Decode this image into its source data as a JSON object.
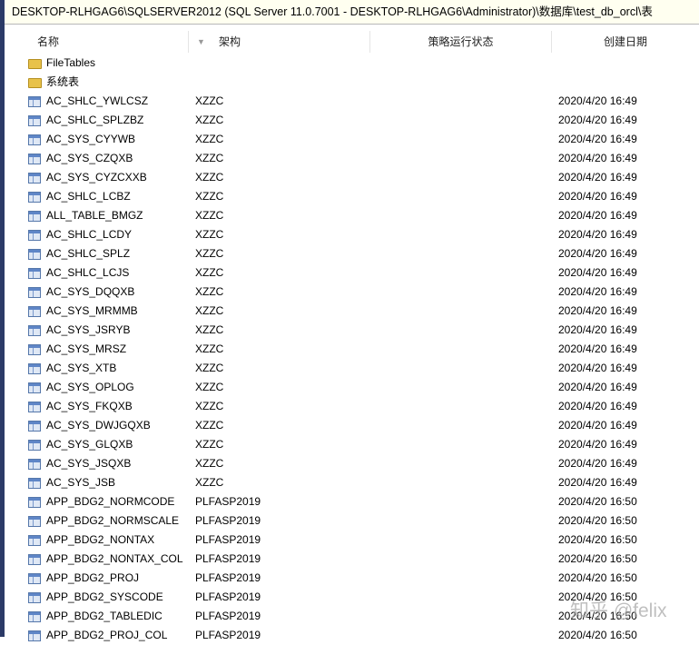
{
  "path": "DESKTOP-RLHGAG6\\SQLSERVER2012 (SQL Server 11.0.7001 - DESKTOP-RLHGAG6\\Administrator)\\数据库\\test_db_orcl\\表",
  "columns": [
    "名称",
    "架构",
    "策略运行状态",
    "创建日期"
  ],
  "folders": [
    "FileTables",
    "系统表"
  ],
  "rows": [
    [
      "AC_SHLC_YWLCSZ",
      "XZZC",
      "2020/4/20 16:49"
    ],
    [
      "AC_SHLC_SPLZBZ",
      "XZZC",
      "2020/4/20 16:49"
    ],
    [
      "AC_SYS_CYYWB",
      "XZZC",
      "2020/4/20 16:49"
    ],
    [
      "AC_SYS_CZQXB",
      "XZZC",
      "2020/4/20 16:49"
    ],
    [
      "AC_SYS_CYZCXXB",
      "XZZC",
      "2020/4/20 16:49"
    ],
    [
      "AC_SHLC_LCBZ",
      "XZZC",
      "2020/4/20 16:49"
    ],
    [
      "ALL_TABLE_BMGZ",
      "XZZC",
      "2020/4/20 16:49"
    ],
    [
      "AC_SHLC_LCDY",
      "XZZC",
      "2020/4/20 16:49"
    ],
    [
      "AC_SHLC_SPLZ",
      "XZZC",
      "2020/4/20 16:49"
    ],
    [
      "AC_SHLC_LCJS",
      "XZZC",
      "2020/4/20 16:49"
    ],
    [
      "AC_SYS_DQQXB",
      "XZZC",
      "2020/4/20 16:49"
    ],
    [
      "AC_SYS_MRMMB",
      "XZZC",
      "2020/4/20 16:49"
    ],
    [
      "AC_SYS_JSRYB",
      "XZZC",
      "2020/4/20 16:49"
    ],
    [
      "AC_SYS_MRSZ",
      "XZZC",
      "2020/4/20 16:49"
    ],
    [
      "AC_SYS_XTB",
      "XZZC",
      "2020/4/20 16:49"
    ],
    [
      "AC_SYS_OPLOG",
      "XZZC",
      "2020/4/20 16:49"
    ],
    [
      "AC_SYS_FKQXB",
      "XZZC",
      "2020/4/20 16:49"
    ],
    [
      "AC_SYS_DWJGQXB",
      "XZZC",
      "2020/4/20 16:49"
    ],
    [
      "AC_SYS_GLQXB",
      "XZZC",
      "2020/4/20 16:49"
    ],
    [
      "AC_SYS_JSQXB",
      "XZZC",
      "2020/4/20 16:49"
    ],
    [
      "AC_SYS_JSB",
      "XZZC",
      "2020/4/20 16:49"
    ],
    [
      "APP_BDG2_NORMCODE",
      "PLFASP2019",
      "2020/4/20 16:50"
    ],
    [
      "APP_BDG2_NORMSCALE",
      "PLFASP2019",
      "2020/4/20 16:50"
    ],
    [
      "APP_BDG2_NONTAX",
      "PLFASP2019",
      "2020/4/20 16:50"
    ],
    [
      "APP_BDG2_NONTAX_COL",
      "PLFASP2019",
      "2020/4/20 16:50"
    ],
    [
      "APP_BDG2_PROJ",
      "PLFASP2019",
      "2020/4/20 16:50"
    ],
    [
      "APP_BDG2_SYSCODE",
      "PLFASP2019",
      "2020/4/20 16:50"
    ],
    [
      "APP_BDG2_TABLEDIC",
      "PLFASP2019",
      "2020/4/20 16:50"
    ],
    [
      "APP_BDG2_PROJ_COL",
      "PLFASP2019",
      "2020/4/20 16:50"
    ]
  ],
  "watermark": "知乎 @felix"
}
